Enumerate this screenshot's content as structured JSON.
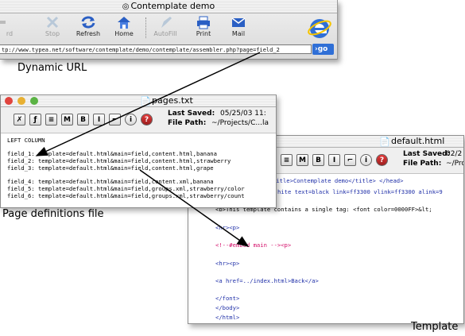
{
  "browser": {
    "title": "Contemplate demo",
    "toolbar": {
      "partial_left": "rd",
      "stop": "Stop",
      "refresh": "Refresh",
      "home": "Home",
      "autofill": "AutoFill",
      "print": "Print",
      "mail": "Mail"
    },
    "url": "tp://www.typea.net/software/contemplate/demo/contemplate/assembler.php?page=field_2",
    "go": "go"
  },
  "captions": {
    "dynamic_url": "Dynamic URL",
    "page_definitions": "Page definitions file",
    "template": "Template"
  },
  "pages_window": {
    "title": "pages.txt",
    "last_saved_label": "Last Saved:",
    "last_saved_value": "05/25/03 11:",
    "file_path_label": "File Path:",
    "file_path_value": "~/Projects/C...la",
    "section": "LEFT COLUMN",
    "lines": [
      "field_1: template=default.html&main=field,content.html,banana",
      "field_2: template=default.html&main=field,content.html,strawberry",
      "field_3: template=default.html&main=field,content.html,grape",
      "field_4: template=default.html&main=field,content.xml,banana",
      "field_5: template=default.html&main=field,groups.xml,strawberry/color",
      "field_6: template=default.html&main=field,groups.xml,strawberry/count"
    ]
  },
  "template_window": {
    "title": "default.html",
    "last_saved_label": "Last Saved:",
    "last_saved_value": "02/2",
    "file_path_label": "File Path:",
    "file_path_value": "~/Proje",
    "lines": [
      "title>Contemplate demo</title> </head>",
      "hite text=black link=ff3300 vlink=ff3300 alink=9",
      "<b>This template contains a single tag: <font color=0000FF>&lt;",
      "<hr><p>",
      "<!--#embed main --><p>",
      "<hr><p>",
      "<a href=../index.html>Back</a>",
      "</font>",
      "</body>",
      "</html>"
    ]
  },
  "colors": {
    "tag_blue": "#1f2fa8",
    "tag_red": "#d40f6a",
    "go_blue": "#2f6fd6"
  }
}
